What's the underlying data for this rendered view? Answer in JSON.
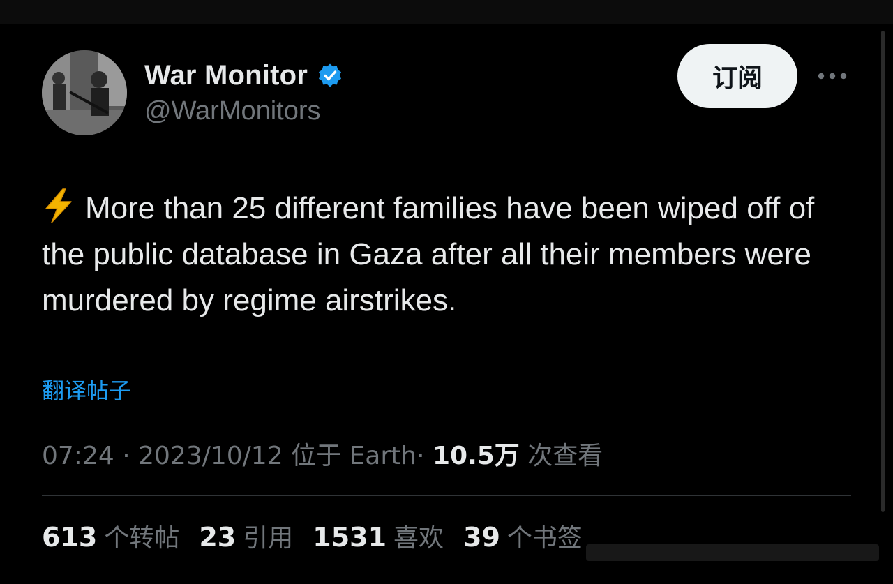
{
  "author": {
    "name": "War Monitor",
    "handle": "@WarMonitors",
    "verified": true
  },
  "subscribe_label": "订阅",
  "tweet": {
    "emoji_icon": "lightning-bolt-icon",
    "text": "More than 25 different families have been wiped off of the public database in Gaza after all their members were murdered by regime airstrikes."
  },
  "translate_label": "翻译帖子",
  "meta": {
    "time": "07:24",
    "separator": "·",
    "date": "2023/10/12",
    "location_prefix": "位于",
    "location": "Earth",
    "views_count": "10.5万",
    "views_label": "次查看"
  },
  "stats": [
    {
      "count": "613",
      "label": "个转帖"
    },
    {
      "count": "23",
      "label": "引用"
    },
    {
      "count": "1531",
      "label": "喜欢"
    },
    {
      "count": "39",
      "label": "个书签"
    }
  ],
  "colors": {
    "background": "#000000",
    "text": "#e7e9ea",
    "muted": "#71767b",
    "link": "#1d9bf0",
    "verified": "#1d9bf0",
    "button_bg": "#eff3f4",
    "divider": "#2f3336",
    "bolt": "#f4b400"
  }
}
